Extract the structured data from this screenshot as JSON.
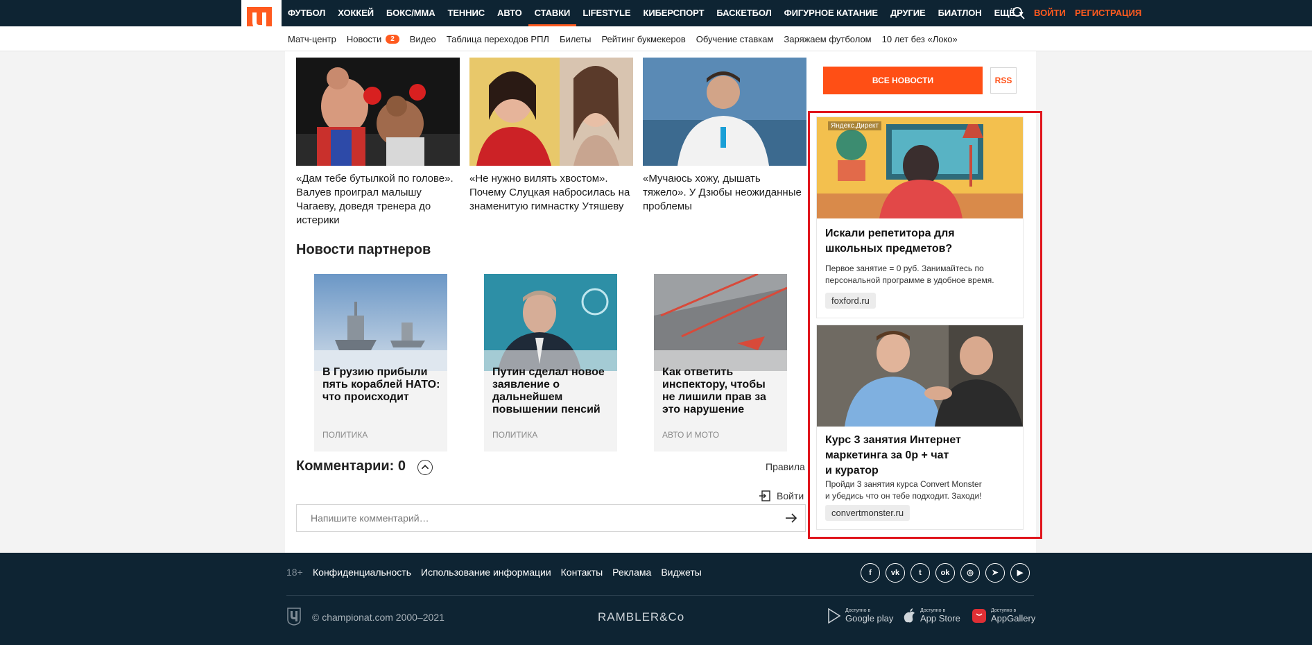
{
  "header": {
    "nav": [
      "ФУТБОЛ",
      "ХОККЕЙ",
      "БОКС/ММА",
      "ТЕННИС",
      "АВТО",
      "СТАВКИ",
      "LIFESTYLE",
      "КИБЕРСПОРТ",
      "БАСКЕТБОЛ",
      "ФИГУРНОЕ КАТАНИЕ",
      "ДРУГИЕ",
      "БИАТЛОН"
    ],
    "more": "ЕЩЁ",
    "login": "ВОЙТИ",
    "register": "РЕГИСТРАЦИЯ",
    "accent_color": "#ff5a1f",
    "bg_color": "#0e2433"
  },
  "subnav": {
    "items": [
      "Матч-центр",
      "Новости",
      "Видео",
      "Таблица переходов РПЛ",
      "Билеты",
      "Рейтинг букмекеров",
      "Обучение ставкам",
      "Заряжаем футболом",
      "10 лет без «Локо»"
    ],
    "news_badge": "2"
  },
  "news": [
    {
      "title": "«Дам тебе бутылкой по голове». Валуев проиграл малышу Чагаеву, доведя тренера до истерики"
    },
    {
      "title": "«Не нужно вилять хвостом». Почему Слуцкая набросилась на знаменитую гимнастку Утяшеву"
    },
    {
      "title": "«Мучаюсь хожу, дышать тяжело». У Дзюбы неожиданные проблемы"
    }
  ],
  "partners": {
    "title": "Новости партнеров",
    "items": [
      {
        "title": "В Грузию прибыли пять кораблей НАТО: что происходит",
        "category": "ПОЛИТИКА"
      },
      {
        "title": "Путин сделал новое заявление о дальнейшем повышении пенсий",
        "category": "ПОЛИТИКА"
      },
      {
        "title": "Как ответить инспектору, чтобы не лишили прав за это нарушение",
        "category": "АВТО И МОТО"
      }
    ]
  },
  "comments": {
    "title": "Комментарии: 0",
    "rules": "Правила",
    "login": "Войти",
    "placeholder": "Напишите комментарий…"
  },
  "sidebar": {
    "all_news": "ВСЕ НОВОСТИ",
    "rss": "RSS"
  },
  "ads": [
    {
      "label": "Яндекс.Директ",
      "title_lines": [
        "Искали репетитора для",
        "школьных предметов?"
      ],
      "text_lines": [
        "Первое занятие = 0 руб. Занимайтесь по",
        "персональной программе в удобное время."
      ],
      "domain": "foxford.ru"
    },
    {
      "title_lines": [
        "Курс 3 занятия Интернет",
        "маркетинга за 0р + чат",
        "и куратор"
      ],
      "text_lines": [
        "Пройди 3 занятия курса Convert Monster",
        "и убедись что он тебе подходит. Заходи!"
      ],
      "domain": "convertmonster.ru"
    }
  ],
  "footer": {
    "age": "18+",
    "links": [
      "Конфиденциальность",
      "Использование информации",
      "Контакты",
      "Реклама",
      "Виджеты"
    ],
    "socials": [
      {
        "icon": "facebook-icon",
        "glyph": "f"
      },
      {
        "icon": "vk-icon",
        "glyph": "vk"
      },
      {
        "icon": "twitter-icon",
        "glyph": "t"
      },
      {
        "icon": "odnoklassniki-icon",
        "glyph": "ok"
      },
      {
        "icon": "instagram-icon",
        "glyph": "◎"
      },
      {
        "icon": "telegram-icon",
        "glyph": "➤"
      },
      {
        "icon": "youtube-icon",
        "glyph": "▶"
      }
    ],
    "copyright": "© championat.com 2000–2021",
    "rambler": "RAMBLER&Co",
    "stores": [
      {
        "pre": "Доступно в",
        "name": "Google play"
      },
      {
        "pre": "Доступно в",
        "name": "App Store"
      },
      {
        "pre": "Доступно в",
        "name": "AppGallery"
      }
    ]
  }
}
